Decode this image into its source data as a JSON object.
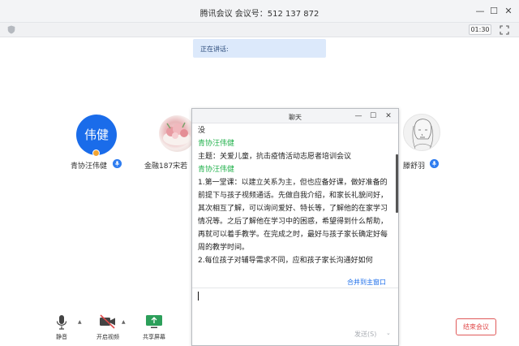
{
  "window": {
    "title": "腾讯会议 会议号：512 137 872",
    "minimize": "—",
    "maximize": "☐",
    "close": "✕"
  },
  "meeting": {
    "timer": "01:30",
    "speaking_label": "正在讲话:"
  },
  "participants": [
    {
      "name": "青协汪伟健",
      "avatar_text": "伟健"
    },
    {
      "name": "金融187宋若"
    },
    {
      "name": "滕舒羽"
    }
  ],
  "toolbar": {
    "mute": "静音",
    "video": "开启视频",
    "share": "共享屏幕",
    "end": "结束会议"
  },
  "chat": {
    "title": "聊天",
    "minimize": "—",
    "maximize": "☐",
    "close": "✕",
    "messages": [
      {
        "type": "text",
        "text": "没"
      },
      {
        "type": "sender",
        "text": "青协汪伟健"
      },
      {
        "type": "text",
        "text": "主题：关爱儿童，抗击疫情活动志愿者培训会议"
      },
      {
        "type": "sender",
        "text": "青协汪伟健"
      },
      {
        "type": "text",
        "text": "1.第一堂课：以建立关系为主，但也应备好课，做好准备的前提下与孩子视频通话。先做自我介绍，和家长礼貌问好，其次相互了解，可以询问爱好、特长等，了解他的在家学习情况等。之后了解他在学习中的困惑，希望得到什么帮助，再就可以着手教学。在完成之时，最好与孩子家长确定好每周的教学时间。"
      },
      {
        "type": "text",
        "text": "2.每位孩子对辅导需求不同，应和孩子家长沟通好如何"
      }
    ],
    "merge_link": "合并到主窗口",
    "send_label": "发送(S)",
    "send_arrow": "⌄"
  },
  "colors": {
    "accent_blue": "#1a6cea",
    "sender_green": "#22b14c",
    "end_red": "#e04a4a",
    "speaking_bg": "#dce9fb"
  },
  "icons": {
    "security": "shield-icon",
    "fullscreen": "fullscreen-icon",
    "mic": "microphone-icon",
    "camera": "camera-off-icon",
    "share": "screen-share-icon"
  }
}
